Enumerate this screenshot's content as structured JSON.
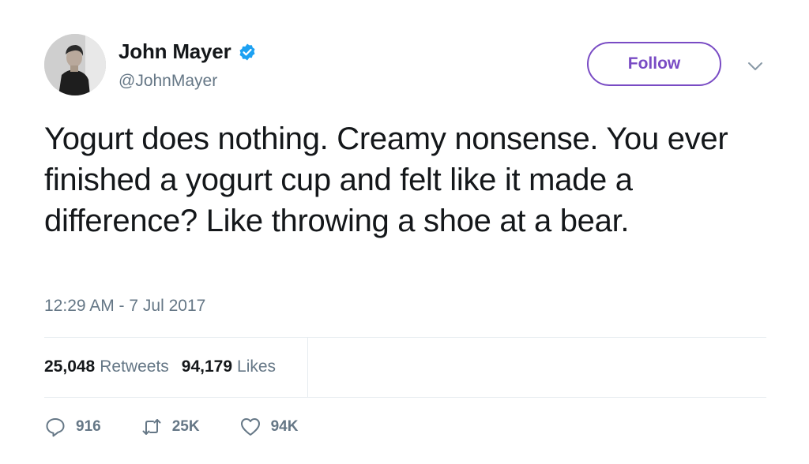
{
  "user": {
    "name": "John Mayer",
    "handle": "@JohnMayer",
    "verified_color": "#1da1f2"
  },
  "follow_label": "Follow",
  "accent_color": "#794bc4",
  "tweet": {
    "text": "Yogurt does nothing. Creamy nonsense. You ever finished a yogurt cup and felt like it made a difference? Like throwing a shoe at a bear.",
    "timestamp": "12:29 AM - 7 Jul 2017"
  },
  "stats": {
    "retweets_count": "25,048",
    "retweets_label": "Retweets",
    "likes_count": "94,179",
    "likes_label": "Likes"
  },
  "actions": {
    "replies": "916",
    "retweets": "25K",
    "likes": "94K"
  },
  "icons": {
    "verified": "verified-badge-icon",
    "caret": "chevron-down-icon",
    "reply": "reply-icon",
    "retweet": "retweet-icon",
    "like": "heart-icon"
  }
}
